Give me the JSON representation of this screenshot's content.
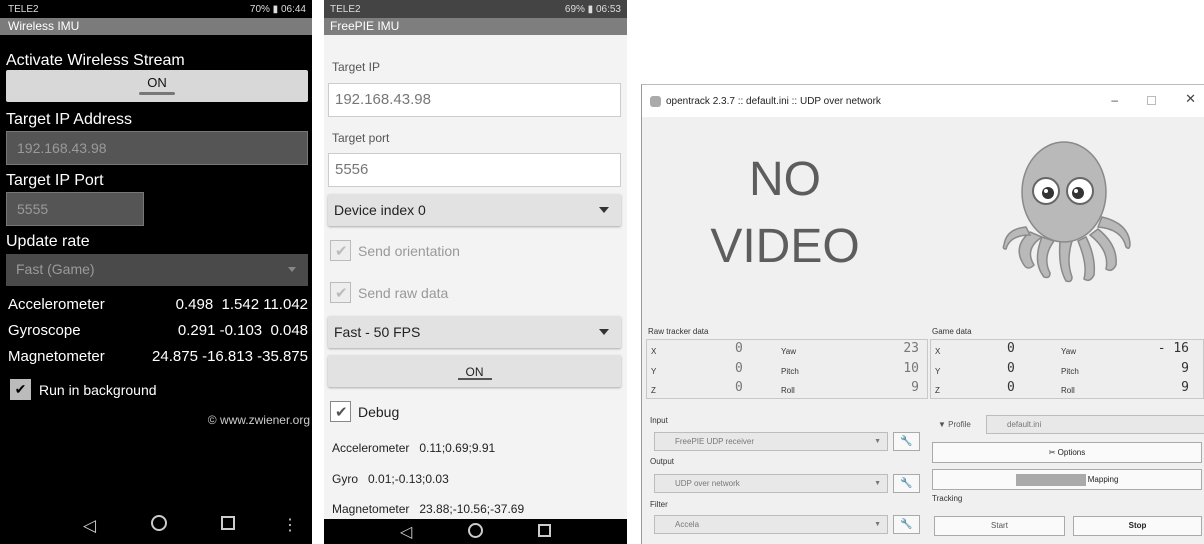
{
  "panel1": {
    "status": {
      "carrier": "TELE2",
      "right": "70%",
      "time": "06:44"
    },
    "app_title": "Wireless IMU",
    "activate_label": "Activate Wireless Stream",
    "activate_button": "ON",
    "ip_label": "Target IP Address",
    "ip_value": "192.168.43.98",
    "port_label": "Target IP Port",
    "port_value": "5555",
    "rate_label": "Update rate",
    "rate_value": "Fast (Game)",
    "sensors": [
      {
        "name": "Accelerometer",
        "value": "0.498  1.542 11.042"
      },
      {
        "name": "Gyroscope",
        "value": "0.291 -0.103  0.048"
      },
      {
        "name": "Magnetometer",
        "value": "24.875 -16.813 -35.875"
      }
    ],
    "background_label": "Run in background",
    "copyright": "© www.zwiener.org"
  },
  "panel2": {
    "status": {
      "carrier": "TELE2",
      "right": "69%",
      "time": "06:53"
    },
    "app_title": "FreePIE IMU",
    "ip_label": "Target IP",
    "ip_value": "192.168.43.98",
    "port_label": "Target port",
    "port_value": "5556",
    "device_index": "Device index 0",
    "send_orientation": "Send orientation",
    "send_raw": "Send raw data",
    "fps": "Fast - 50 FPS",
    "on_button": "ON",
    "debug": "Debug",
    "accel": "Accelerometer   0.11;0.69;9.91",
    "gyro": "Gyro   0.01;-0.13;0.03",
    "magnet": "Magnetometer   23.88;-10.56;-37.69"
  },
  "panel3": {
    "window_title": "opentrack 2.3.7 :: default.ini :: UDP over network",
    "no_video_1": "NO",
    "no_video_2": "VIDEO",
    "raw_label": "Raw tracker data",
    "game_label": "Game data",
    "raw_rows": [
      {
        "axis": "X",
        "axis_val": "0",
        "rot": "Yaw",
        "rot_val": "23"
      },
      {
        "axis": "Y",
        "axis_val": "0",
        "rot": "Pitch",
        "rot_val": "10"
      },
      {
        "axis": "Z",
        "axis_val": "0",
        "rot": "Roll",
        "rot_val": "9"
      }
    ],
    "game_rows": [
      {
        "axis": "X",
        "axis_val": "0",
        "rot": "Yaw",
        "rot_val": "- 16"
      },
      {
        "axis": "Y",
        "axis_val": "0",
        "rot": "Pitch",
        "rot_val": "9"
      },
      {
        "axis": "Z",
        "axis_val": "0",
        "rot": "Roll",
        "rot_val": "9"
      }
    ],
    "input_label": "Input",
    "input_value": "FreePIE UDP receiver",
    "output_label": "Output",
    "output_value": "UDP over network",
    "filter_label": "Filter",
    "filter_value": "Accela",
    "profile_label": "Profile",
    "profile_value": "default.ini",
    "options_label": "Options",
    "mapping_label": "Mapping",
    "tracking_label": "Tracking",
    "start_label": "Start",
    "stop_label": "Stop"
  }
}
